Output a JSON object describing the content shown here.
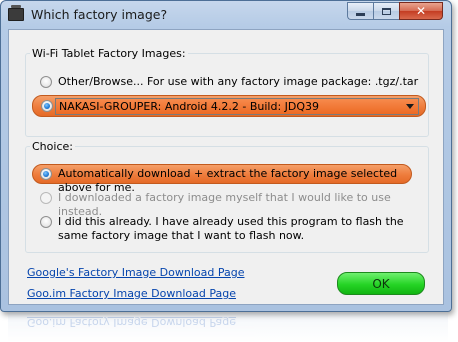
{
  "window": {
    "title": "Which factory image?"
  },
  "images_group": {
    "legend": "Wi-Fi Tablet Factory Images:",
    "other_option": "Other/Browse...   For use with any factory image package: .tgz/.tar",
    "selected_image": "NAKASI-GROUPER: Android 4.2.2 - Build: JDQ39"
  },
  "choice_group": {
    "legend": "Choice:",
    "options": [
      {
        "label": "Automatically download + extract the factory image selected above for me.",
        "checked": true,
        "enabled": true
      },
      {
        "label": "I downloaded a factory image myself that I would like to use instead.",
        "checked": false,
        "enabled": false
      },
      {
        "label": "I did this already. I have already used this program to flash the same factory image that I want to flash now.",
        "checked": false,
        "enabled": true
      }
    ]
  },
  "links": {
    "google": "Google's Factory Image Download Page",
    "gooim": "Goo.im Factory Image Download Page"
  },
  "ok_label": "OK",
  "colors": {
    "highlight_orange": "#ee7c3c",
    "ok_green": "#25d425",
    "link_blue": "#0645ad"
  }
}
